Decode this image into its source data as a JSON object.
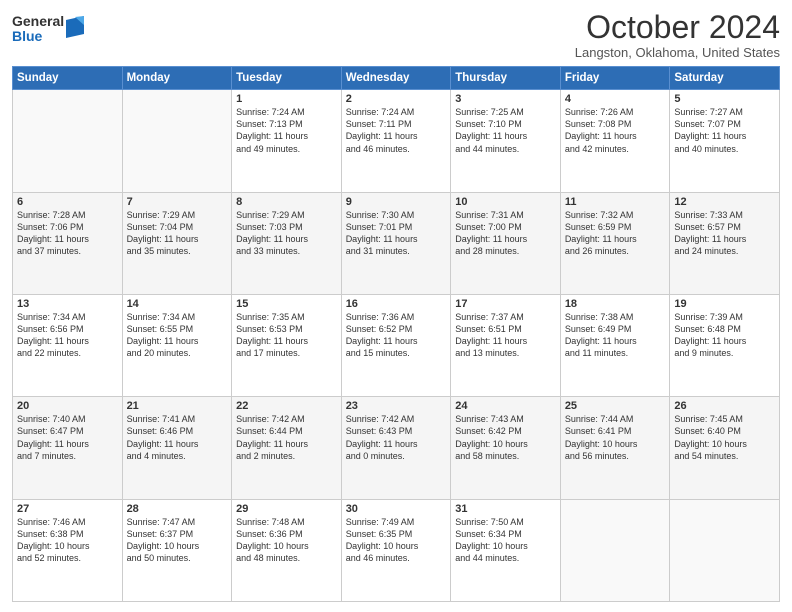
{
  "logo": {
    "general": "General",
    "blue": "Blue"
  },
  "title": "October 2024",
  "location": "Langston, Oklahoma, United States",
  "days_header": [
    "Sunday",
    "Monday",
    "Tuesday",
    "Wednesday",
    "Thursday",
    "Friday",
    "Saturday"
  ],
  "weeks": [
    [
      {
        "day": "",
        "info": ""
      },
      {
        "day": "",
        "info": ""
      },
      {
        "day": "1",
        "info": "Sunrise: 7:24 AM\nSunset: 7:13 PM\nDaylight: 11 hours\nand 49 minutes."
      },
      {
        "day": "2",
        "info": "Sunrise: 7:24 AM\nSunset: 7:11 PM\nDaylight: 11 hours\nand 46 minutes."
      },
      {
        "day": "3",
        "info": "Sunrise: 7:25 AM\nSunset: 7:10 PM\nDaylight: 11 hours\nand 44 minutes."
      },
      {
        "day": "4",
        "info": "Sunrise: 7:26 AM\nSunset: 7:08 PM\nDaylight: 11 hours\nand 42 minutes."
      },
      {
        "day": "5",
        "info": "Sunrise: 7:27 AM\nSunset: 7:07 PM\nDaylight: 11 hours\nand 40 minutes."
      }
    ],
    [
      {
        "day": "6",
        "info": "Sunrise: 7:28 AM\nSunset: 7:06 PM\nDaylight: 11 hours\nand 37 minutes."
      },
      {
        "day": "7",
        "info": "Sunrise: 7:29 AM\nSunset: 7:04 PM\nDaylight: 11 hours\nand 35 minutes."
      },
      {
        "day": "8",
        "info": "Sunrise: 7:29 AM\nSunset: 7:03 PM\nDaylight: 11 hours\nand 33 minutes."
      },
      {
        "day": "9",
        "info": "Sunrise: 7:30 AM\nSunset: 7:01 PM\nDaylight: 11 hours\nand 31 minutes."
      },
      {
        "day": "10",
        "info": "Sunrise: 7:31 AM\nSunset: 7:00 PM\nDaylight: 11 hours\nand 28 minutes."
      },
      {
        "day": "11",
        "info": "Sunrise: 7:32 AM\nSunset: 6:59 PM\nDaylight: 11 hours\nand 26 minutes."
      },
      {
        "day": "12",
        "info": "Sunrise: 7:33 AM\nSunset: 6:57 PM\nDaylight: 11 hours\nand 24 minutes."
      }
    ],
    [
      {
        "day": "13",
        "info": "Sunrise: 7:34 AM\nSunset: 6:56 PM\nDaylight: 11 hours\nand 22 minutes."
      },
      {
        "day": "14",
        "info": "Sunrise: 7:34 AM\nSunset: 6:55 PM\nDaylight: 11 hours\nand 20 minutes."
      },
      {
        "day": "15",
        "info": "Sunrise: 7:35 AM\nSunset: 6:53 PM\nDaylight: 11 hours\nand 17 minutes."
      },
      {
        "day": "16",
        "info": "Sunrise: 7:36 AM\nSunset: 6:52 PM\nDaylight: 11 hours\nand 15 minutes."
      },
      {
        "day": "17",
        "info": "Sunrise: 7:37 AM\nSunset: 6:51 PM\nDaylight: 11 hours\nand 13 minutes."
      },
      {
        "day": "18",
        "info": "Sunrise: 7:38 AM\nSunset: 6:49 PM\nDaylight: 11 hours\nand 11 minutes."
      },
      {
        "day": "19",
        "info": "Sunrise: 7:39 AM\nSunset: 6:48 PM\nDaylight: 11 hours\nand 9 minutes."
      }
    ],
    [
      {
        "day": "20",
        "info": "Sunrise: 7:40 AM\nSunset: 6:47 PM\nDaylight: 11 hours\nand 7 minutes."
      },
      {
        "day": "21",
        "info": "Sunrise: 7:41 AM\nSunset: 6:46 PM\nDaylight: 11 hours\nand 4 minutes."
      },
      {
        "day": "22",
        "info": "Sunrise: 7:42 AM\nSunset: 6:44 PM\nDaylight: 11 hours\nand 2 minutes."
      },
      {
        "day": "23",
        "info": "Sunrise: 7:42 AM\nSunset: 6:43 PM\nDaylight: 11 hours\nand 0 minutes."
      },
      {
        "day": "24",
        "info": "Sunrise: 7:43 AM\nSunset: 6:42 PM\nDaylight: 10 hours\nand 58 minutes."
      },
      {
        "day": "25",
        "info": "Sunrise: 7:44 AM\nSunset: 6:41 PM\nDaylight: 10 hours\nand 56 minutes."
      },
      {
        "day": "26",
        "info": "Sunrise: 7:45 AM\nSunset: 6:40 PM\nDaylight: 10 hours\nand 54 minutes."
      }
    ],
    [
      {
        "day": "27",
        "info": "Sunrise: 7:46 AM\nSunset: 6:38 PM\nDaylight: 10 hours\nand 52 minutes."
      },
      {
        "day": "28",
        "info": "Sunrise: 7:47 AM\nSunset: 6:37 PM\nDaylight: 10 hours\nand 50 minutes."
      },
      {
        "day": "29",
        "info": "Sunrise: 7:48 AM\nSunset: 6:36 PM\nDaylight: 10 hours\nand 48 minutes."
      },
      {
        "day": "30",
        "info": "Sunrise: 7:49 AM\nSunset: 6:35 PM\nDaylight: 10 hours\nand 46 minutes."
      },
      {
        "day": "31",
        "info": "Sunrise: 7:50 AM\nSunset: 6:34 PM\nDaylight: 10 hours\nand 44 minutes."
      },
      {
        "day": "",
        "info": ""
      },
      {
        "day": "",
        "info": ""
      }
    ]
  ]
}
